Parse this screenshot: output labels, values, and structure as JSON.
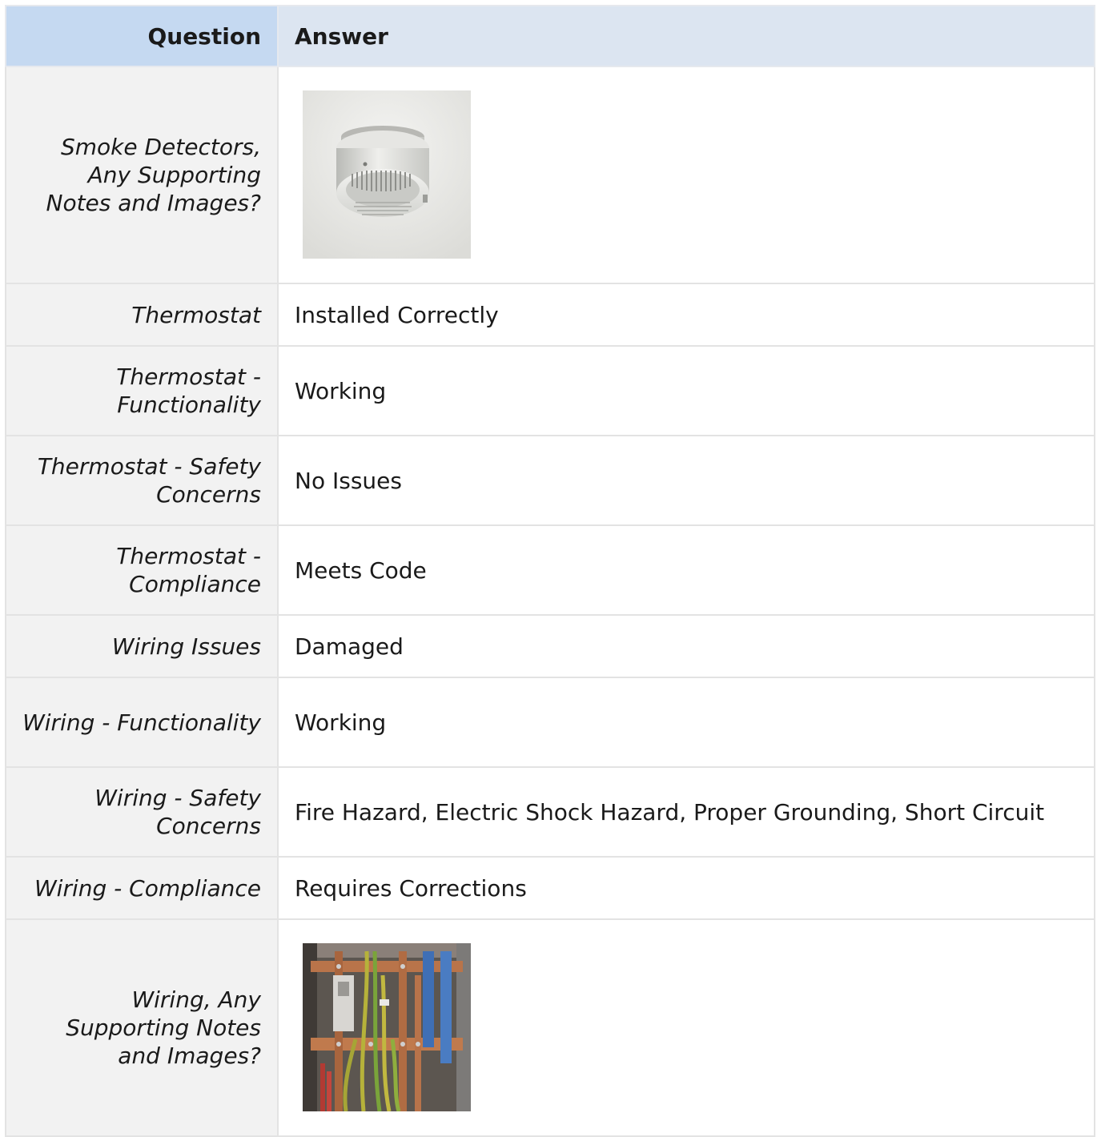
{
  "table": {
    "header": {
      "question": "Question",
      "answer": "Answer"
    },
    "rows": [
      {
        "question": "Smoke Detectors, Any Supporting Notes and Images?",
        "answer_image": "smoke-detector-photo"
      },
      {
        "question": "Thermostat",
        "answer": "Installed Correctly"
      },
      {
        "question": "Thermostat - Functionality",
        "answer": "Working"
      },
      {
        "question": "Thermostat - Safety Concerns",
        "answer": "No Issues"
      },
      {
        "question": "Thermostat - Compliance",
        "answer": "Meets Code"
      },
      {
        "question": "Wiring Issues",
        "answer": "Damaged"
      },
      {
        "question": "Wiring - Functionality",
        "answer": "Working"
      },
      {
        "question": "Wiring - Safety Concerns",
        "answer": "Fire Hazard, Electric Shock Hazard, Proper Grounding, Short Circuit"
      },
      {
        "question": "Wiring - Compliance",
        "answer": "Requires Corrections"
      },
      {
        "question": "Wiring, Any Supporting Notes and Images?",
        "answer_image": "electrical-wiring-photo"
      }
    ]
  },
  "colors": {
    "question_header_bg": "#c5d9f1",
    "answer_header_bg": "#dce5f1",
    "question_cell_bg": "#f2f2f2",
    "answer_cell_bg": "#ffffff",
    "border": "#e3e3e3"
  }
}
